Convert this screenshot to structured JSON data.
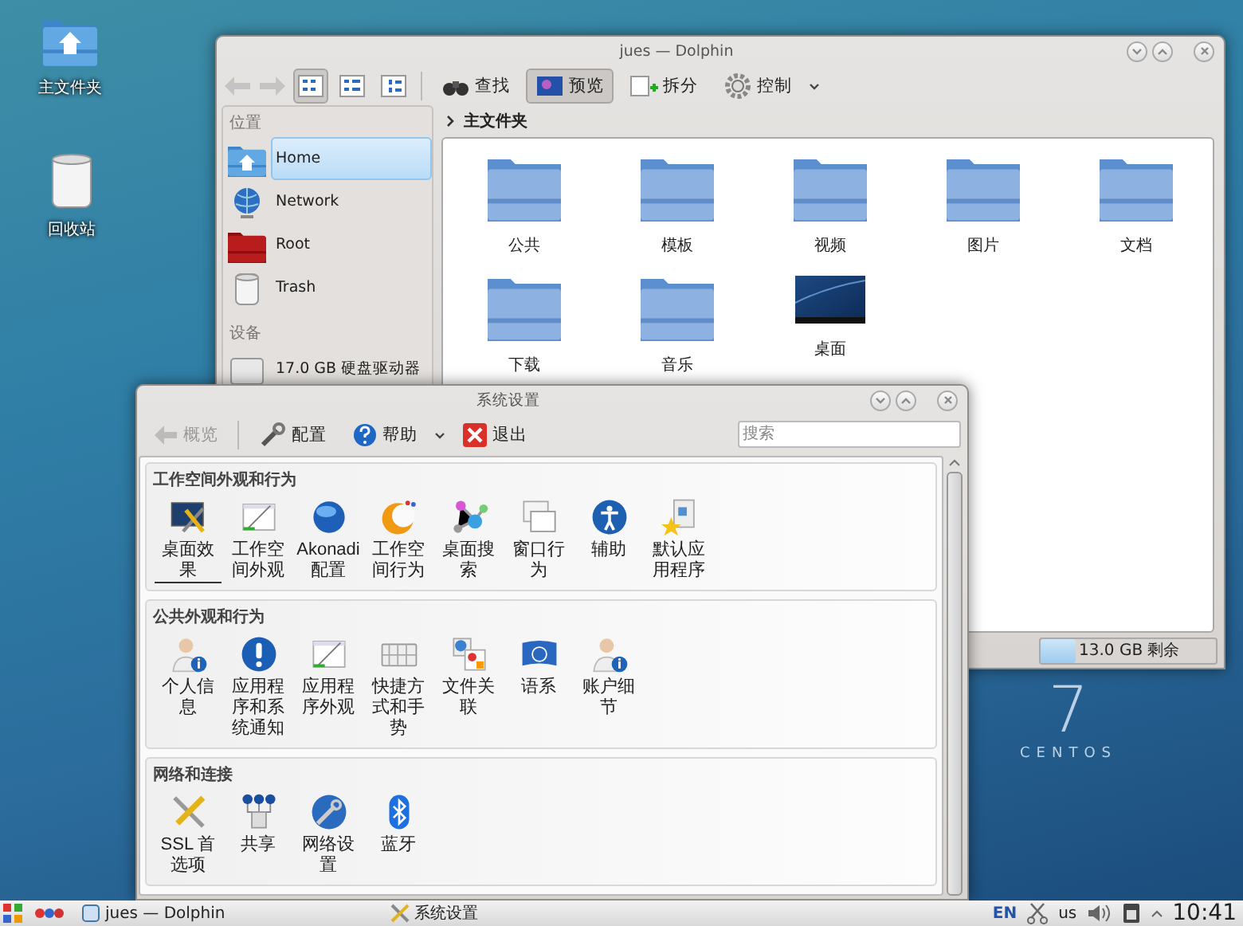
{
  "desktop": {
    "icons": [
      {
        "label": "主文件夹"
      },
      {
        "label": "回收站"
      }
    ],
    "logo": {
      "numeral": "7",
      "text": "CENTOS"
    }
  },
  "dolphin": {
    "title": "jues — Dolphin",
    "view_modes": [
      {
        "selected": true
      },
      {
        "selected": false
      },
      {
        "selected": false
      }
    ],
    "actions": [
      {
        "label": "查找",
        "pressed": false
      },
      {
        "label": "预览",
        "pressed": true
      },
      {
        "label": "拆分",
        "pressed": false
      },
      {
        "label": "控制",
        "pressed": false
      }
    ],
    "sidebar": [
      {
        "title": "位置",
        "items": [
          {
            "label": "Home",
            "selected": true
          },
          {
            "label": "Network",
            "selected": false
          },
          {
            "label": "Root",
            "selected": false
          },
          {
            "label": "Trash",
            "selected": false
          }
        ]
      },
      {
        "title": "设备",
        "items": [
          {
            "label": "17.0 GB 硬盘驱动器",
            "selected": false
          }
        ]
      }
    ],
    "breadcrumb": "主文件夹",
    "files": [
      {
        "name": "公共",
        "kind": "folder"
      },
      {
        "name": "模板",
        "kind": "folder"
      },
      {
        "name": "视频",
        "kind": "folder"
      },
      {
        "name": "图片",
        "kind": "folder"
      },
      {
        "name": "文档",
        "kind": "folder"
      },
      {
        "name": "下载",
        "kind": "folder"
      },
      {
        "name": "音乐",
        "kind": "folder"
      },
      {
        "name": "桌面",
        "kind": "desktop"
      }
    ],
    "free_space": {
      "text": "13.0 GB 剩余",
      "level": 0.2
    }
  },
  "settings": {
    "title": "系统设置",
    "toolbar": [
      {
        "label": "概览",
        "disabled": true,
        "menu": false
      },
      {
        "label": "配置",
        "disabled": false,
        "menu": false
      },
      {
        "label": "帮助",
        "disabled": false,
        "menu": true
      },
      {
        "label": "退出",
        "disabled": false,
        "menu": false
      }
    ],
    "search": {
      "placeholder": "搜索"
    },
    "groups": [
      {
        "title": "工作空间外观和行为",
        "items": [
          {
            "label": "桌面效果",
            "selected": true
          },
          {
            "label": "工作空间外观",
            "selected": false
          },
          {
            "label": "Akonadi 配置",
            "selected": false
          },
          {
            "label": "工作空间行为",
            "selected": false
          },
          {
            "label": "桌面搜索",
            "selected": false
          },
          {
            "label": "窗口行为",
            "selected": false
          },
          {
            "label": "辅助",
            "selected": false
          },
          {
            "label": "默认应用程序",
            "selected": false
          }
        ]
      },
      {
        "title": "公共外观和行为",
        "items": [
          {
            "label": "个人信息",
            "selected": false
          },
          {
            "label": "应用程序和系统通知",
            "selected": false
          },
          {
            "label": "应用程序外观",
            "selected": false
          },
          {
            "label": "快捷方式和手势",
            "selected": false
          },
          {
            "label": "文件关联",
            "selected": false
          },
          {
            "label": "语系",
            "selected": false
          },
          {
            "label": "账户细节",
            "selected": false
          }
        ]
      },
      {
        "title": "网络和连接",
        "items": [
          {
            "label": "SSL 首选项",
            "selected": false
          },
          {
            "label": "共享",
            "selected": false
          },
          {
            "label": "网络设置",
            "selected": false
          },
          {
            "label": "蓝牙",
            "selected": false
          }
        ]
      }
    ]
  },
  "taskbar": {
    "tasks": [
      {
        "label": "jues — Dolphin"
      },
      {
        "label": "系统设置"
      }
    ],
    "keyboard": "EN",
    "layout": "us",
    "clock": "10:41"
  }
}
